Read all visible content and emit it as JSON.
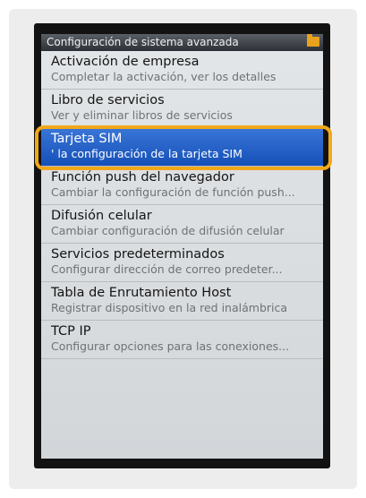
{
  "window": {
    "title": "Configuración de sistema avanzada",
    "icon": "folder-icon"
  },
  "menu": {
    "items": [
      {
        "title": "Activación de empresa",
        "subtitle": "Completar la activación, ver los detalles"
      },
      {
        "title": "Libro de servicios",
        "subtitle": "Ver y eliminar libros de servicios"
      },
      {
        "title": "Tarjeta SIM",
        "subtitle": "' la configuración de la tarjeta SIM",
        "selected": true
      },
      {
        "title": "Función push del navegador",
        "subtitle": "Cambiar la configuración de función push..."
      },
      {
        "title": "Difusión celular",
        "subtitle": "Cambiar configuración de difusión celular"
      },
      {
        "title": "Servicios predeterminados",
        "subtitle": "Configurar dirección de correo predeter..."
      },
      {
        "title": "Tabla de Enrutamiento Host",
        "subtitle": "Registrar dispositivo en la red inalámbrica"
      },
      {
        "title": "TCP IP",
        "subtitle": "Configurar opciones para las conexiones..."
      }
    ]
  },
  "colors": {
    "selection": "#1e5cc8",
    "highlight_border": "#f0a81b"
  }
}
